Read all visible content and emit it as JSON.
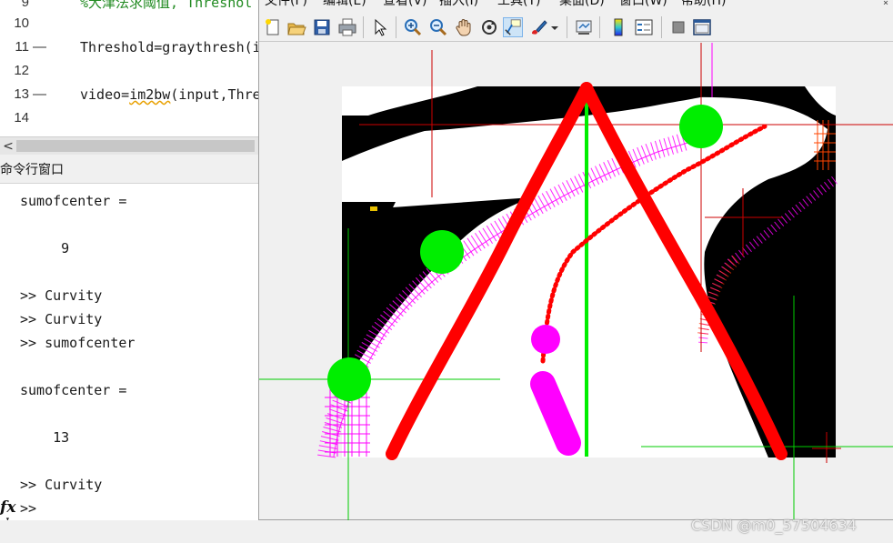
{
  "editor": {
    "lines": [
      {
        "no": "9",
        "dash": "",
        "text": "%大津法求阈值, Threshol",
        "comment": true
      },
      {
        "no": "10",
        "dash": "",
        "text": "",
        "comment": false
      },
      {
        "no": "11",
        "dash": "—",
        "text": "Threshold=graythresh(i",
        "comment": false
      },
      {
        "no": "12",
        "dash": "",
        "text": "",
        "comment": false
      },
      {
        "no": "13",
        "dash": "—",
        "text_before": "video=",
        "func": "im2bw",
        "text_after": "(input,Thre",
        "comment": false
      },
      {
        "no": "14",
        "dash": "",
        "text": "",
        "comment": false
      }
    ],
    "scroll_left_glyph": "<"
  },
  "command_window": {
    "title": "命令行窗口",
    "lines": [
      "sumofcenter =",
      "",
      "     9",
      "",
      ">> Curvity",
      ">> Curvity",
      ">> sumofcenter",
      "",
      "sumofcenter =",
      "",
      "    13",
      "",
      ">> Curvity"
    ],
    "prompt": ">>",
    "fx_label": "fx"
  },
  "figure": {
    "menu": [
      "文件(F)",
      "编辑(E)",
      "查看(V)",
      "插入(I)",
      "工具(T)",
      "桌面(D)",
      "窗口(W)",
      "帮助(H)"
    ],
    "close_glyph": "×",
    "toolbar_icons": [
      "new-figure-icon",
      "open-file-icon",
      "save-icon",
      "print-icon",
      "select-arrow-icon",
      "zoom-in-icon",
      "zoom-out-icon",
      "pan-hand-icon",
      "rotate-3d-icon",
      "data-cursor-icon",
      "brush-icon",
      "link-plot-icon",
      "insert-colorbar-icon",
      "insert-legend-icon",
      "hide-plot-tools-icon",
      "show-plot-tools-icon"
    ],
    "colors": {
      "red": "#ff0000",
      "green": "#00ee00",
      "magenta": "#ff00ff",
      "black": "#000000",
      "white": "#ffffff"
    }
  },
  "watermark": "CSDN @m0_57504634"
}
